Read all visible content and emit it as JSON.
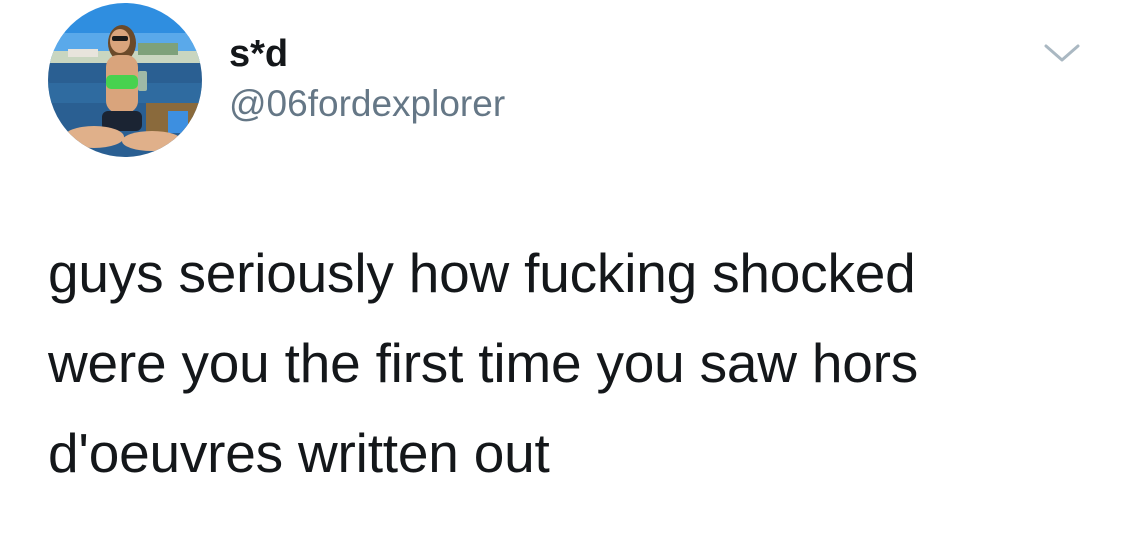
{
  "author": {
    "display_name": "s*d",
    "handle": "@06fordexplorer",
    "avatar_icon": "profile-photo"
  },
  "menu": {
    "icon": "chevron-down-icon"
  },
  "tweet": {
    "lines": [
      "guys seriously how fucking shocked",
      "were you the first time you saw hors",
      "d'oeuvres written out"
    ]
  },
  "colors": {
    "text": "#14171a",
    "secondary": "#657786",
    "caret": "#aab8c2",
    "background": "#ffffff"
  }
}
